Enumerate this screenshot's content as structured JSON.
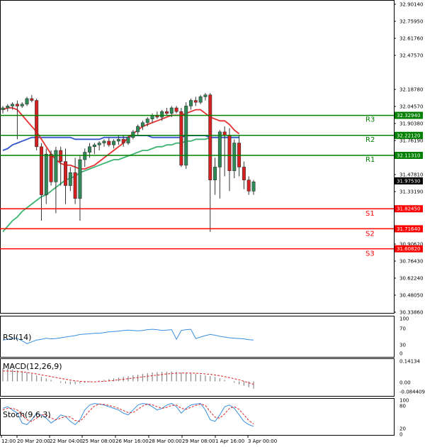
{
  "chart_data": {
    "type": "candlestick",
    "symbol_price_current": "31.97530",
    "price_axis": {
      "ylim": [
        31.3,
        32.93
      ],
      "ticks": [
        "32.90140",
        "32.75950",
        "32.61760",
        "32.47570",
        "32.18780",
        "32.04570",
        "31.90380",
        "31.76190",
        "31.47810",
        "31.33190",
        "31.19000",
        "31.04810",
        "30.90620",
        "30.76430",
        "30.62240",
        "30.48050",
        "30.33860"
      ]
    },
    "time_axis": {
      "labels": [
        "12:00",
        "20 Mar 20:00",
        "22 Mar 04:00",
        "25 Mar 08:00",
        "26 Mar 16:00",
        "28 Mar 00:00",
        "29 Mar 08:00",
        "1 Apr 16:00",
        "3 Apr 00:00"
      ]
    },
    "levels": [
      {
        "name": "R3",
        "value": 32.3294,
        "label": "32.32940",
        "color": "#008000"
      },
      {
        "name": "R2",
        "value": 32.2212,
        "label": "32.22120",
        "color": "#008000"
      },
      {
        "name": "R1",
        "value": 32.1131,
        "label": "32.11310",
        "color": "#008000"
      },
      {
        "name": "S1",
        "value": 31.8245,
        "label": "31.82450",
        "color": "#ff0000"
      },
      {
        "name": "S2",
        "value": 31.7164,
        "label": "31.71640",
        "color": "#ff0000"
      },
      {
        "name": "S3",
        "value": 31.6082,
        "label": "31.60820",
        "color": "#ff0000"
      }
    ],
    "candles": [
      [
        32.36,
        32.38,
        32.34,
        32.37
      ],
      [
        32.37,
        32.39,
        32.35,
        32.38
      ],
      [
        32.38,
        32.4,
        32.36,
        32.39
      ],
      [
        32.39,
        32.41,
        32.2,
        32.38
      ],
      [
        32.38,
        32.4,
        32.37,
        32.39
      ],
      [
        32.39,
        32.43,
        32.38,
        32.42
      ],
      [
        32.42,
        32.44,
        32.4,
        32.41
      ],
      [
        32.41,
        32.42,
        32.14,
        32.16
      ],
      [
        32.16,
        32.18,
        31.76,
        31.9
      ],
      [
        31.9,
        32.15,
        31.85,
        32.12
      ],
      [
        32.12,
        32.14,
        31.95,
        31.97
      ],
      [
        31.97,
        32.16,
        31.8,
        32.14
      ],
      [
        32.14,
        32.16,
        31.95,
        32.08
      ],
      [
        32.08,
        32.15,
        31.85,
        31.95
      ],
      [
        31.95,
        32.05,
        31.92,
        32.02
      ],
      [
        32.02,
        32.1,
        31.85,
        31.88
      ],
      [
        31.88,
        32.11,
        31.76,
        32.09
      ],
      [
        32.09,
        32.15,
        32.05,
        32.13
      ],
      [
        32.13,
        32.18,
        32.1,
        32.16
      ],
      [
        32.16,
        32.18,
        32.12,
        32.17
      ],
      [
        32.17,
        32.19,
        32.14,
        32.18
      ],
      [
        32.18,
        32.2,
        32.16,
        32.19
      ],
      [
        32.19,
        32.21,
        32.16,
        32.17
      ],
      [
        32.17,
        32.2,
        32.15,
        32.19
      ],
      [
        32.19,
        32.22,
        32.17,
        32.2
      ],
      [
        32.2,
        32.22,
        32.16,
        32.18
      ],
      [
        32.18,
        32.22,
        32.17,
        32.21
      ],
      [
        32.21,
        32.25,
        32.2,
        32.24
      ],
      [
        32.24,
        32.28,
        32.22,
        32.27
      ],
      [
        32.27,
        32.3,
        32.25,
        32.29
      ],
      [
        32.29,
        32.32,
        32.27,
        32.31
      ],
      [
        32.31,
        32.34,
        32.29,
        32.33
      ],
      [
        32.33,
        32.35,
        32.31,
        32.32
      ],
      [
        32.32,
        32.36,
        32.3,
        32.35
      ],
      [
        32.35,
        32.37,
        32.33,
        32.34
      ],
      [
        32.34,
        32.38,
        32.32,
        32.37
      ],
      [
        32.37,
        32.38,
        32.34,
        32.35
      ],
      [
        32.35,
        32.37,
        32.05,
        32.06
      ],
      [
        32.06,
        32.4,
        32.04,
        32.38
      ],
      [
        32.38,
        32.42,
        32.36,
        32.41
      ],
      [
        32.41,
        32.43,
        32.38,
        32.4
      ],
      [
        32.4,
        32.44,
        32.39,
        32.43
      ],
      [
        32.43,
        32.45,
        32.41,
        32.44
      ],
      [
        32.44,
        32.45,
        31.7,
        31.98
      ],
      [
        31.98,
        32.1,
        31.9,
        32.05
      ],
      [
        32.05,
        32.25,
        31.88,
        32.24
      ],
      [
        32.24,
        32.27,
        32.0,
        32.22
      ],
      [
        32.22,
        32.26,
        31.92,
        32.03
      ],
      [
        32.03,
        32.2,
        31.99,
        32.18
      ],
      [
        32.18,
        32.22,
        32.0,
        32.05
      ],
      [
        32.05,
        32.08,
        31.93,
        31.98
      ],
      [
        31.98,
        32.0,
        31.9,
        31.92
      ],
      [
        31.92,
        31.98,
        31.9,
        31.97
      ]
    ],
    "ma_red": [
      32.36,
      32.37,
      32.37,
      32.36,
      32.33,
      32.3,
      32.27,
      32.24,
      32.2,
      32.16,
      32.12,
      32.09,
      32.07,
      32.06,
      32.06,
      32.05,
      32.04,
      32.04,
      32.05,
      32.06,
      32.08,
      32.1,
      32.12,
      32.14,
      32.16,
      32.18,
      32.21,
      32.23,
      32.25,
      32.27,
      32.28,
      32.29,
      32.3,
      32.31,
      32.32,
      32.33,
      32.33,
      32.33,
      32.34,
      32.35,
      32.36,
      32.36,
      32.34,
      32.32,
      32.31,
      32.3,
      32.3,
      32.28,
      32.25,
      32.23
    ],
    "ma_blue": [
      32.14,
      32.15,
      32.17,
      32.18,
      32.19,
      32.2,
      32.21,
      32.21,
      32.21,
      32.21,
      32.21,
      32.21,
      32.21,
      32.21,
      32.21,
      32.2,
      32.2,
      32.2,
      32.2,
      32.2,
      32.2,
      32.21,
      32.21,
      32.21,
      32.21,
      32.21,
      32.21,
      32.22,
      32.22,
      32.22,
      32.22,
      32.21,
      32.21,
      32.21,
      32.21,
      32.21,
      32.21,
      32.21,
      32.22,
      32.22,
      32.22,
      32.22,
      32.22,
      32.21,
      32.21,
      32.21,
      32.21,
      32.21,
      32.21,
      32.21
    ],
    "ma_green": [
      31.7,
      31.73,
      31.76,
      31.78,
      31.81,
      31.83,
      31.85,
      31.87,
      31.89,
      31.9,
      31.92,
      31.94,
      31.96,
      31.98,
      31.99,
      32.0,
      32.02,
      32.03,
      32.04,
      32.05,
      32.06,
      32.07,
      32.08,
      32.09,
      32.09,
      32.1,
      32.11,
      32.12,
      32.13,
      32.14,
      32.14,
      32.15,
      32.16,
      32.16,
      32.17,
      32.17,
      32.18,
      32.18,
      32.19,
      32.19,
      32.2,
      32.2,
      32.2,
      32.21,
      32.21,
      32.21,
      32.21,
      32.21,
      32.21,
      32.21
    ],
    "rsi": {
      "title": "RSI(14)",
      "ticks": [
        "100",
        "70",
        "30",
        "0"
      ],
      "values": [
        40,
        42,
        45,
        44,
        38,
        30,
        35,
        40,
        42,
        45,
        43,
        44,
        46,
        48,
        50,
        52,
        55,
        56,
        57,
        58,
        58,
        60,
        62,
        63,
        64,
        66,
        67,
        66,
        65,
        66,
        68,
        69,
        68,
        66,
        67,
        68,
        42,
        66,
        68,
        69,
        44,
        48,
        52,
        55,
        53,
        50,
        48,
        46,
        45,
        44,
        43,
        41,
        40
      ]
    },
    "macd": {
      "title": "MACD(12,26,9)",
      "ticks": [
        "0.14134",
        "0.00",
        "-0.084409"
      ],
      "hist": [
        0.09,
        0.085,
        0.08,
        0.075,
        0.07,
        0.06,
        0.05,
        0.04,
        0.03,
        0.02,
        0.01,
        0.0,
        -0.01,
        -0.015,
        -0.02,
        -0.02,
        -0.015,
        -0.01,
        -0.005,
        0.0,
        0.005,
        0.01,
        0.015,
        0.02,
        0.025,
        0.03,
        0.035,
        0.04,
        0.045,
        0.05,
        0.055,
        0.06,
        0.062,
        0.064,
        0.066,
        0.066,
        0.064,
        0.06,
        0.058,
        0.056,
        0.05,
        0.045,
        0.04,
        0.035,
        0.03,
        0.02,
        0.01,
        0.0,
        -0.01,
        -0.02,
        -0.03,
        -0.04,
        -0.05
      ],
      "signal": [
        0.07,
        0.07,
        0.068,
        0.066,
        0.064,
        0.06,
        0.055,
        0.05,
        0.044,
        0.038,
        0.032,
        0.026,
        0.02,
        0.014,
        0.008,
        0.004,
        0.0,
        -0.002,
        -0.003,
        -0.003,
        -0.002,
        0.0,
        0.003,
        0.006,
        0.01,
        0.014,
        0.018,
        0.022,
        0.026,
        0.03,
        0.034,
        0.038,
        0.042,
        0.046,
        0.05,
        0.053,
        0.055,
        0.056,
        0.056,
        0.056,
        0.055,
        0.053,
        0.05,
        0.047,
        0.043,
        0.038,
        0.032,
        0.025,
        0.018,
        0.01,
        0.0,
        -0.01,
        -0.02
      ]
    },
    "stoch": {
      "title": "Stoch(9,6,3)",
      "ticks": [
        "100",
        "80",
        "20",
        "0"
      ],
      "k": [
        75,
        80,
        70,
        60,
        30,
        25,
        40,
        60,
        55,
        45,
        30,
        40,
        55,
        50,
        35,
        25,
        40,
        70,
        85,
        90,
        88,
        85,
        80,
        75,
        70,
        60,
        55,
        70,
        85,
        90,
        88,
        80,
        70,
        75,
        85,
        90,
        80,
        60,
        75,
        85,
        88,
        90,
        70,
        40,
        35,
        55,
        80,
        85,
        75,
        55,
        35,
        25,
        20
      ],
      "d": [
        70,
        75,
        75,
        70,
        55,
        40,
        35,
        45,
        55,
        55,
        45,
        40,
        45,
        50,
        48,
        38,
        35,
        50,
        68,
        82,
        88,
        87,
        84,
        80,
        75,
        68,
        62,
        62,
        72,
        82,
        88,
        86,
        80,
        75,
        78,
        84,
        85,
        75,
        72,
        78,
        84,
        88,
        84,
        65,
        48,
        45,
        58,
        75,
        80,
        72,
        55,
        38,
        27
      ]
    }
  }
}
